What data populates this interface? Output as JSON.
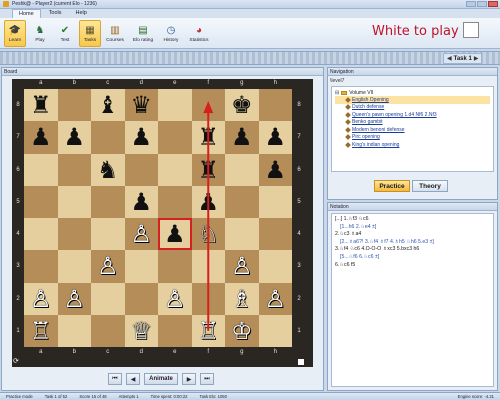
{
  "window": {
    "title": "Peshk@ - Player2 (current Elo - 1236)"
  },
  "ribbon_tabs": [
    "Home",
    "Tools",
    "Help"
  ],
  "ribbon_buttons": [
    {
      "label": "Learn",
      "icon": "graduation-icon"
    },
    {
      "label": "Play",
      "icon": "board-icon"
    },
    {
      "label": "Test",
      "icon": "checklist-icon"
    },
    {
      "label": "Tasks",
      "icon": "task-icon"
    },
    {
      "label": "Courses",
      "icon": "books-icon"
    },
    {
      "label": "Elo rating",
      "icon": "chart-icon"
    },
    {
      "label": "History",
      "icon": "clock-icon"
    },
    {
      "label": "Statistics",
      "icon": "pie-icon"
    }
  ],
  "status_message": "White to play",
  "task_nav": {
    "label": "Task 1"
  },
  "board": {
    "panel_title": "Board",
    "files": [
      "a",
      "b",
      "c",
      "d",
      "e",
      "f",
      "g",
      "h"
    ],
    "ranks": [
      "8",
      "7",
      "6",
      "5",
      "4",
      "3",
      "2",
      "1"
    ],
    "squares": [
      [
        "♜",
        "",
        "♝",
        "♛",
        "",
        "",
        "♚",
        ""
      ],
      [
        "♟",
        "♟",
        "",
        "♟",
        "",
        "♜",
        "♟",
        "♟"
      ],
      [
        "",
        "",
        "♞",
        "",
        "",
        "♜",
        "",
        "♟"
      ],
      [
        "",
        "",
        "",
        "♟",
        "",
        "♟",
        "",
        ""
      ],
      [
        "",
        "",
        "",
        "♙",
        "♟",
        "♘",
        "",
        ""
      ],
      [
        "",
        "",
        "♙",
        "",
        "",
        "",
        "♙",
        ""
      ],
      [
        "♙",
        "♙",
        "",
        "",
        "♙",
        "",
        "♗",
        "♙"
      ],
      [
        "♖",
        "",
        "",
        "♕",
        "",
        "♖",
        "♔",
        ""
      ]
    ],
    "colors": [
      [
        "b",
        "",
        "b",
        "b",
        "",
        "",
        "b",
        ""
      ],
      [
        "b",
        "b",
        "",
        "b",
        "",
        "b",
        "b",
        "b"
      ],
      [
        "",
        "",
        "b",
        "",
        "",
        "b",
        "",
        "b"
      ],
      [
        "",
        "",
        "",
        "b",
        "",
        "b",
        "",
        ""
      ],
      [
        "",
        "",
        "",
        "w",
        "b",
        "w",
        "",
        ""
      ],
      [
        "",
        "",
        "w",
        "",
        "",
        "",
        "w",
        ""
      ],
      [
        "w",
        "w",
        "",
        "",
        "w",
        "",
        "w",
        "w"
      ],
      [
        "w",
        "",
        "",
        "w",
        "",
        "w",
        "w",
        ""
      ]
    ],
    "highlight": "e4",
    "arrow": {
      "from": "f1",
      "to": "f8",
      "color": "#d62020"
    },
    "controls": {
      "animate": "Animate"
    }
  },
  "navigation": {
    "panel_title": "Navigation",
    "path": "\\level7",
    "root": "Volume VII",
    "items": [
      "English Opening",
      "Dutch defense",
      "Queen's pawn opening 1.d4 Nf6 2.Nf3",
      "Benko gambit",
      "Modern benoni defense",
      "Pirc opening",
      "King's indian opening"
    ],
    "practice_label": "Practice",
    "theory_label": "Theory"
  },
  "notation": {
    "panel_title": "Notation",
    "lines": [
      {
        "text": "[...] 1.♘f3 ♘c6",
        "variation": false
      },
      {
        "text": "[1...h6 2.♘e4 ±]",
        "variation": true
      },
      {
        "text": "2.♘c3 ♗a4",
        "variation": false
      },
      {
        "text": "[2...♗a6?! 3.♘f4 ♗f7 4.♗h5 ♘h6 5.e3 ±]",
        "variation": true
      },
      {
        "text": "3.♘f4 ♘c6 4.O-O-O ♗xc3 5.bxc3 h6",
        "variation": false
      },
      {
        "text": "[5...♘f6 6.♘c6 ±]",
        "variation": true
      },
      {
        "text": "6.♘c6 f5",
        "variation": false
      }
    ]
  },
  "statusbar": {
    "mode": "Practice mode",
    "task": "Task 1 of 52",
    "score": "Score 15 of 48",
    "attempts": "Attempts 1",
    "time": "Time spent: 0:00:22",
    "task_elo": "Task Elo: 1050",
    "engine": "Engine score: -4.21"
  }
}
